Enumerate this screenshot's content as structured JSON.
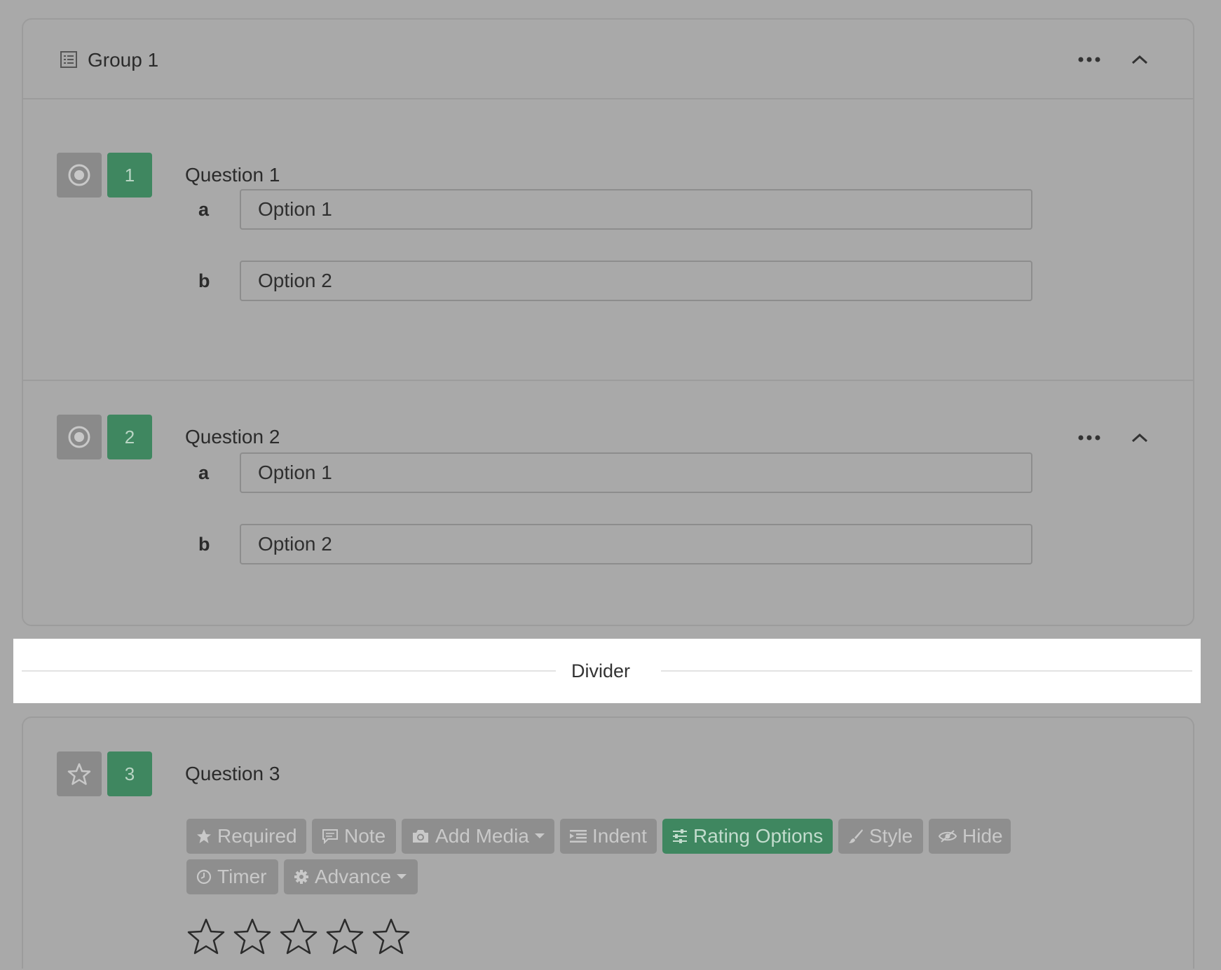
{
  "group": {
    "title": "Group 1"
  },
  "questions": [
    {
      "number": "1",
      "title": "Question 1",
      "type_icon": "radio-icon",
      "options": [
        {
          "letter": "a",
          "value": "Option 1"
        },
        {
          "letter": "b",
          "value": "Option 2"
        }
      ]
    },
    {
      "number": "2",
      "title": "Question 2",
      "type_icon": "radio-icon",
      "options": [
        {
          "letter": "a",
          "value": "Option 1"
        },
        {
          "letter": "b",
          "value": "Option 2"
        }
      ]
    },
    {
      "number": "3",
      "title": "Question 3",
      "type_icon": "star-icon",
      "rating_stars": 5
    }
  ],
  "divider": {
    "label": "Divider"
  },
  "toolbar": {
    "required": "Required",
    "note": "Note",
    "add_media": "Add Media",
    "indent": "Indent",
    "rating_options": "Rating Options",
    "style": "Style",
    "hide": "Hide",
    "timer": "Timer",
    "advance": "Advance"
  },
  "colors": {
    "accent": "#3f8760",
    "overlay": "#a9a9a9"
  }
}
